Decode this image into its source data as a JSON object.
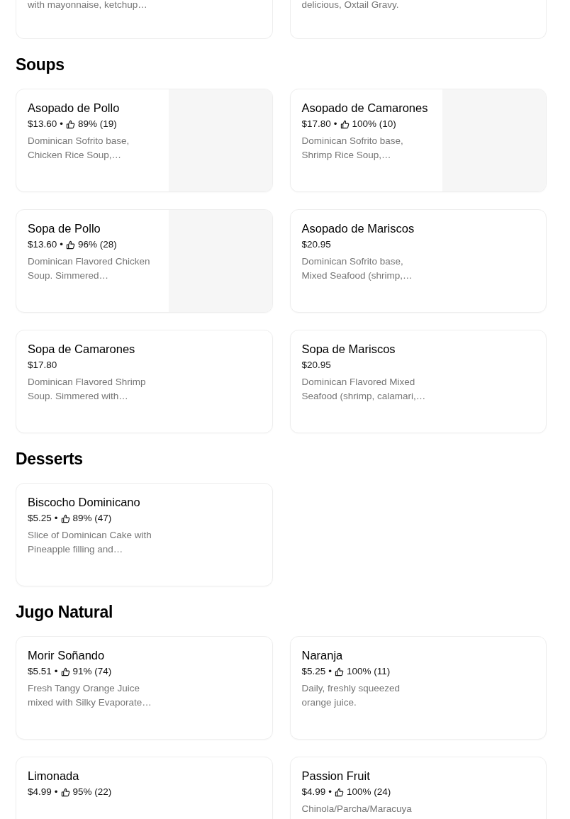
{
  "partial_items": [
    {
      "description": "with mayonnaise, ketchup…"
    },
    {
      "description": "delicious, Oxtail Gravy."
    }
  ],
  "sections": [
    {
      "title": "Soups",
      "items": [
        {
          "name": "Asopado de Pollo",
          "price": "$13.60",
          "separator": "•",
          "rating": "89% (19)",
          "description": "Dominican Sofrito base, Chicken Rice Soup,…",
          "has_image": true
        },
        {
          "name": "Asopado de Camarones",
          "price": "$17.80",
          "separator": "•",
          "rating": "100% (10)",
          "description": "Dominican Sofrito base, Shrimp Rice Soup,…",
          "has_image": true
        },
        {
          "name": "Sopa de Pollo",
          "price": "$13.60",
          "separator": "•",
          "rating": "96% (28)",
          "description": "Dominican Flavored Chicken Soup. Simmered…",
          "has_image": true
        },
        {
          "name": "Asopado de Mariscos",
          "price": "$20.95",
          "description": "Dominican Sofrito base, Mixed Seafood (shrimp,…",
          "has_image": false
        },
        {
          "name": "Sopa de Camarones",
          "price": "$17.80",
          "description": "Dominican Flavored Shrimp Soup. Simmered with…",
          "has_image": false
        },
        {
          "name": "Sopa de Mariscos",
          "price": "$20.95",
          "description": "Dominican Flavored Mixed Seafood (shrimp, calamari,…",
          "has_image": false
        }
      ]
    },
    {
      "title": "Desserts",
      "items": [
        {
          "name": "Biscocho Dominicano",
          "price": "$5.25",
          "separator": "•",
          "rating": "89% (47)",
          "description": "Slice of Dominican Cake with Pineapple filling and…",
          "has_image": false
        }
      ]
    },
    {
      "title": "Jugo Natural",
      "items": [
        {
          "name": "Morir Soñando",
          "price": "$5.51",
          "separator": "•",
          "rating": "91% (74)",
          "description": "Fresh Tangy Orange Juice mixed with Silky Evaporate…",
          "has_image": false
        },
        {
          "name": "Naranja",
          "price": "$5.25",
          "separator": "•",
          "rating": "100% (11)",
          "description": "Daily, freshly squeezed orange juice.",
          "has_image": false
        },
        {
          "name": "Limonada",
          "price": "$4.99",
          "separator": "•",
          "rating": "95% (22)",
          "has_image": false
        },
        {
          "name": "Passion Fruit",
          "price": "$4.99",
          "separator": "•",
          "rating": "100% (24)",
          "description": "Chinola/Parcha/Maracuya",
          "has_image": false
        }
      ]
    }
  ]
}
